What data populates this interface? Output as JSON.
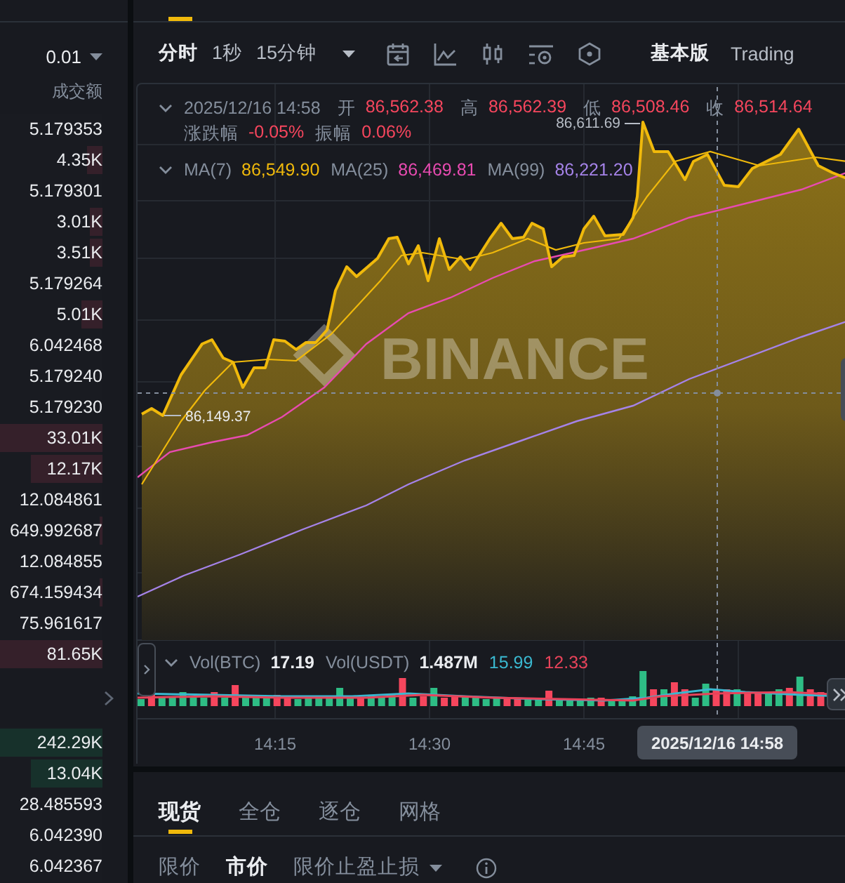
{
  "order_book": {
    "precision": "0.01",
    "column_header": "成交额",
    "asks": [
      {
        "value": "5.179353"
      },
      {
        "value": "4.35K",
        "level": 0.15
      },
      {
        "value": "5.179301"
      },
      {
        "value": "3.01K",
        "level": 0.13
      },
      {
        "value": "3.51K",
        "level": 0.13
      },
      {
        "value": "5.179264"
      },
      {
        "value": "5.01K",
        "level": 0.2
      },
      {
        "value": "6.042468"
      },
      {
        "value": "5.179240"
      },
      {
        "value": "5.179230"
      },
      {
        "value": "33.01K",
        "level": 1
      },
      {
        "value": "12.17K",
        "level": 0.7
      },
      {
        "value": "12.084861"
      },
      {
        "value": "649.992687",
        "level": 0.03
      },
      {
        "value": "12.084855"
      },
      {
        "value": "674.159434",
        "level": 0.03
      },
      {
        "value": "75.961617"
      },
      {
        "value": "81.65K",
        "level": 1
      }
    ],
    "bids": [
      {
        "value": "242.29K",
        "level": 1
      },
      {
        "value": "13.04K",
        "level": 0.7
      },
      {
        "value": "28.485593"
      },
      {
        "value": "6.042390"
      },
      {
        "value": "6.042367"
      }
    ]
  },
  "chart": {
    "intervals": [
      {
        "label": "分时",
        "selected": true
      },
      {
        "label": "1秒",
        "selected": false
      },
      {
        "label": "15分钟",
        "selected": false
      }
    ],
    "views": [
      {
        "label": "基本版",
        "selected": true
      },
      {
        "label": "Trading",
        "selected": false
      }
    ],
    "datetime": "2025/12/16 14:58",
    "ohlc": [
      {
        "label": "开",
        "value": "86,562.38"
      },
      {
        "label": "高",
        "value": "86,562.39"
      },
      {
        "label": "低",
        "value": "86,508.46"
      },
      {
        "label": "收",
        "value": "86,514.64"
      }
    ],
    "change": [
      {
        "label": "涨跌幅",
        "value": "-0.05%"
      },
      {
        "label": "振幅",
        "value": "0.06%"
      }
    ],
    "ma": [
      {
        "label": "MA(7)",
        "value": "86,549.90",
        "color": "#f0b90b"
      },
      {
        "label": "MA(25)",
        "value": "86,469.81",
        "color": "#e84bb1"
      },
      {
        "label": "MA(99)",
        "value": "86,221.20",
        "color": "#a583e8"
      }
    ],
    "watermark": "BINANCE",
    "high_label": "86,611.69",
    "low_label": "86,149.37",
    "volume": [
      {
        "label": "Vol(BTC)",
        "value": "17.19"
      },
      {
        "label": "Vol(USDT)",
        "value": "1.487M"
      }
    ],
    "volume_ma": [
      {
        "value": "15.99",
        "color": "#3ab8d0"
      },
      {
        "value": "12.33",
        "color": "#e8435a"
      }
    ],
    "time_ticks": [
      "14:15",
      "14:30",
      "14:45"
    ],
    "crosshair_time": "2025/12/16 14:58"
  },
  "trade": {
    "tabs": [
      {
        "label": "现货",
        "selected": true
      },
      {
        "label": "全仓",
        "selected": false
      },
      {
        "label": "逐仓",
        "selected": false
      },
      {
        "label": "网格",
        "selected": false
      }
    ],
    "order_types": [
      {
        "label": "限价",
        "selected": false,
        "dropdown": false
      },
      {
        "label": "市价",
        "selected": true,
        "dropdown": false
      },
      {
        "label": "限价止盈止损",
        "selected": false,
        "dropdown": true
      }
    ]
  }
}
